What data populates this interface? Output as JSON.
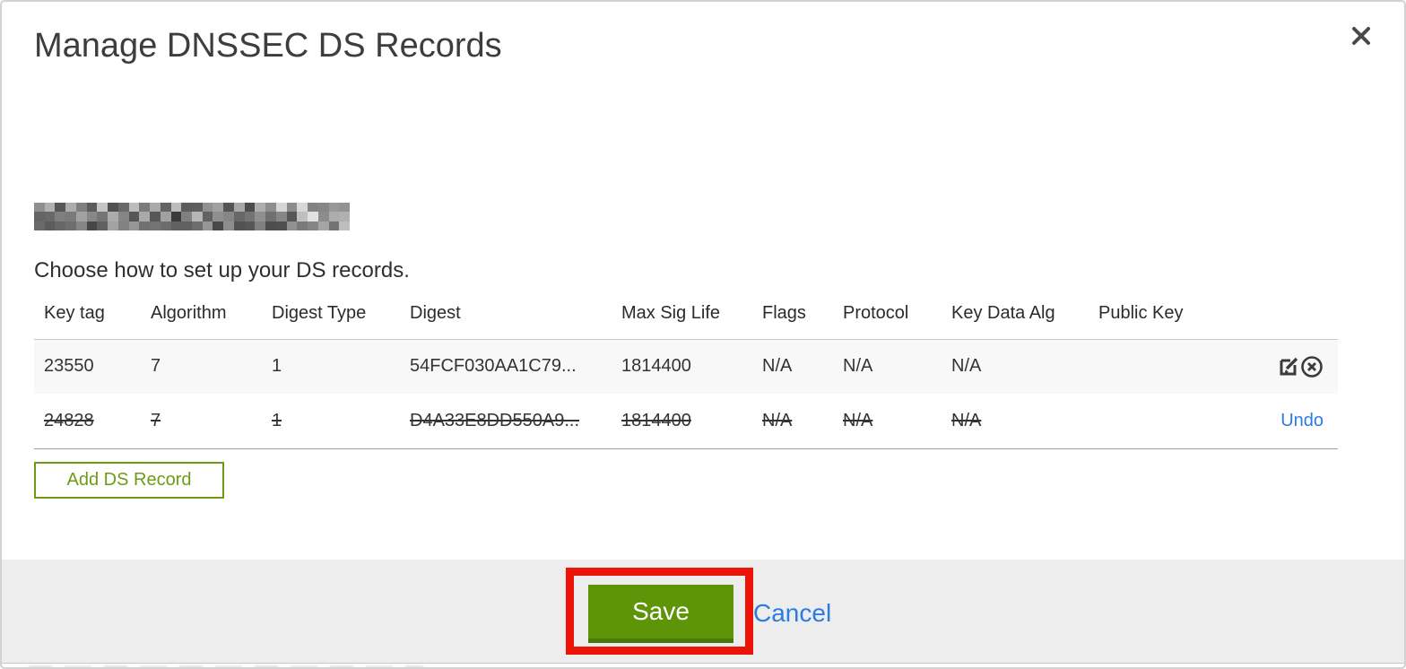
{
  "dialog": {
    "title": "Manage DNSSEC DS Records",
    "intro": "Choose how to set up your DS records.",
    "domain_redacted": true,
    "add_button_label": "Add DS Record",
    "footer": {
      "save_label": "Save",
      "cancel_label": "Cancel"
    },
    "icons": {
      "close": "close-icon",
      "edit": "edit-record-icon",
      "delete": "delete-record-icon"
    }
  },
  "table": {
    "columns": [
      "Key tag",
      "Algorithm",
      "Digest Type",
      "Digest",
      "Max Sig Life",
      "Flags",
      "Protocol",
      "Key Data Alg",
      "Public Key"
    ],
    "rows": [
      {
        "key_tag": "23550",
        "algorithm": "7",
        "digest_type": "1",
        "digest": "54FCF030AA1C79...",
        "max_sig_life": "1814400",
        "flags": "N/A",
        "protocol": "N/A",
        "key_data_alg": "N/A",
        "public_key": "",
        "deleted": false,
        "actions": [
          "edit",
          "delete"
        ]
      },
      {
        "key_tag": "24828",
        "algorithm": "7",
        "digest_type": "1",
        "digest": "D4A33E8DD550A9...",
        "max_sig_life": "1814400",
        "flags": "N/A",
        "protocol": "N/A",
        "key_data_alg": "N/A",
        "public_key": "",
        "deleted": true,
        "undo_label": "Undo"
      }
    ]
  },
  "colors": {
    "accent_green": "#5d9408",
    "outline_green": "#6c9c13",
    "link_blue": "#2a7ce0",
    "annotation_red": "#ec1409",
    "footer_gray": "#ededed",
    "text_dark": "#333333"
  }
}
